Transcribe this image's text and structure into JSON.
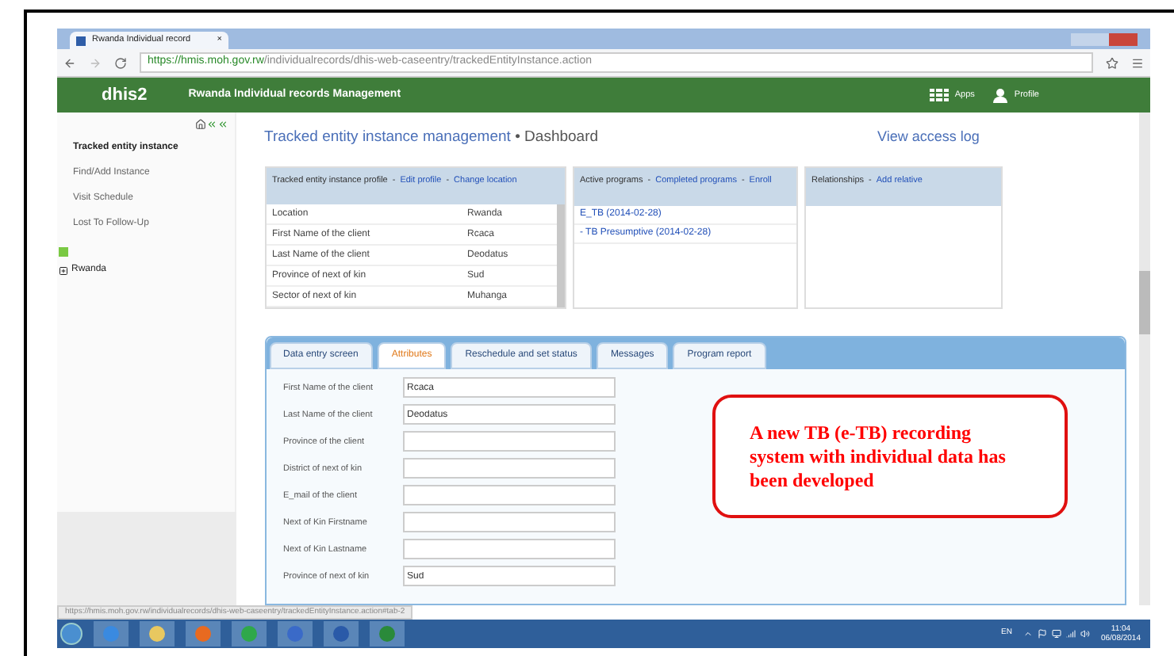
{
  "browser": {
    "tab": "Rwanda Individual record",
    "tab_close": "×",
    "url_host": "https://hmis.moh.gov.rw",
    "url_path": "/individualrecords/dhis-web-caseentry/trackedEntityInstance.action"
  },
  "header": {
    "logo": "dhis2",
    "title": "Rwanda Individual records Management",
    "apps": "Apps",
    "profile": "Profile"
  },
  "sidebar": {
    "items": [
      {
        "label": "Tracked entity instance",
        "selected": true
      },
      {
        "label": "Find/Add Instance",
        "selected": false
      },
      {
        "label": "Visit Schedule",
        "selected": false
      },
      {
        "label": "Lost To Follow-Up",
        "selected": false
      }
    ],
    "tree": [
      {
        "label": "Rwanda",
        "expanded": false
      }
    ]
  },
  "page": {
    "title": "Tracked entity instance management",
    "separator": "•",
    "subtitle": "Dashboard",
    "access_log": "View access log"
  },
  "link_separator": "-",
  "profile_panel": {
    "title": "Tracked entity instance profile",
    "links": [
      "Edit profile",
      "Change location"
    ],
    "rows": [
      {
        "label": "Location",
        "value": "Rwanda"
      },
      {
        "label": "First Name of the client",
        "value": "Rcaca"
      },
      {
        "label": "Last Name of the client",
        "value": "Deodatus"
      },
      {
        "label": "Province of next of kin",
        "value": "Sud"
      },
      {
        "label": "Sector of next of kin",
        "value": "Muhanga"
      }
    ]
  },
  "programs_panel": {
    "title": "Active programs",
    "links": [
      "Completed programs",
      "Enroll"
    ],
    "items": [
      "E_TB (2014-02-28)",
      "- TB Presumptive (2014-02-28)"
    ]
  },
  "relationships_panel": {
    "title": "Relationships",
    "links": [
      "Add relative"
    ]
  },
  "tabs": [
    {
      "label": "Data entry screen",
      "selected": false
    },
    {
      "label": "Attributes",
      "selected": true
    },
    {
      "label": "Reschedule and set status",
      "selected": false
    },
    {
      "label": "Messages",
      "selected": false
    },
    {
      "label": "Program report",
      "selected": false
    }
  ],
  "attributes": [
    {
      "label": "First Name of the client",
      "value": "Rcaca"
    },
    {
      "label": "Last Name of the client",
      "value": "Deodatus"
    },
    {
      "label": "Province of the client"
    },
    {
      "label": "District of next of kin"
    },
    {
      "label": "E_mail of the client"
    },
    {
      "label": "Next of Kin Firstname"
    },
    {
      "label": "Next of Kin Lastname"
    },
    {
      "label": "Province of next of kin",
      "value": "Sud"
    }
  ],
  "callout": "A new TB (e-TB) recording system with individual data has been developed",
  "status_url": "https://hmis.moh.gov.rw/individualrecords/dhis-web-caseentry/trackedEntityInstance.action#tab-2",
  "taskbar": {
    "language": "EN",
    "time": "11:04",
    "date": "06/08/2014"
  }
}
